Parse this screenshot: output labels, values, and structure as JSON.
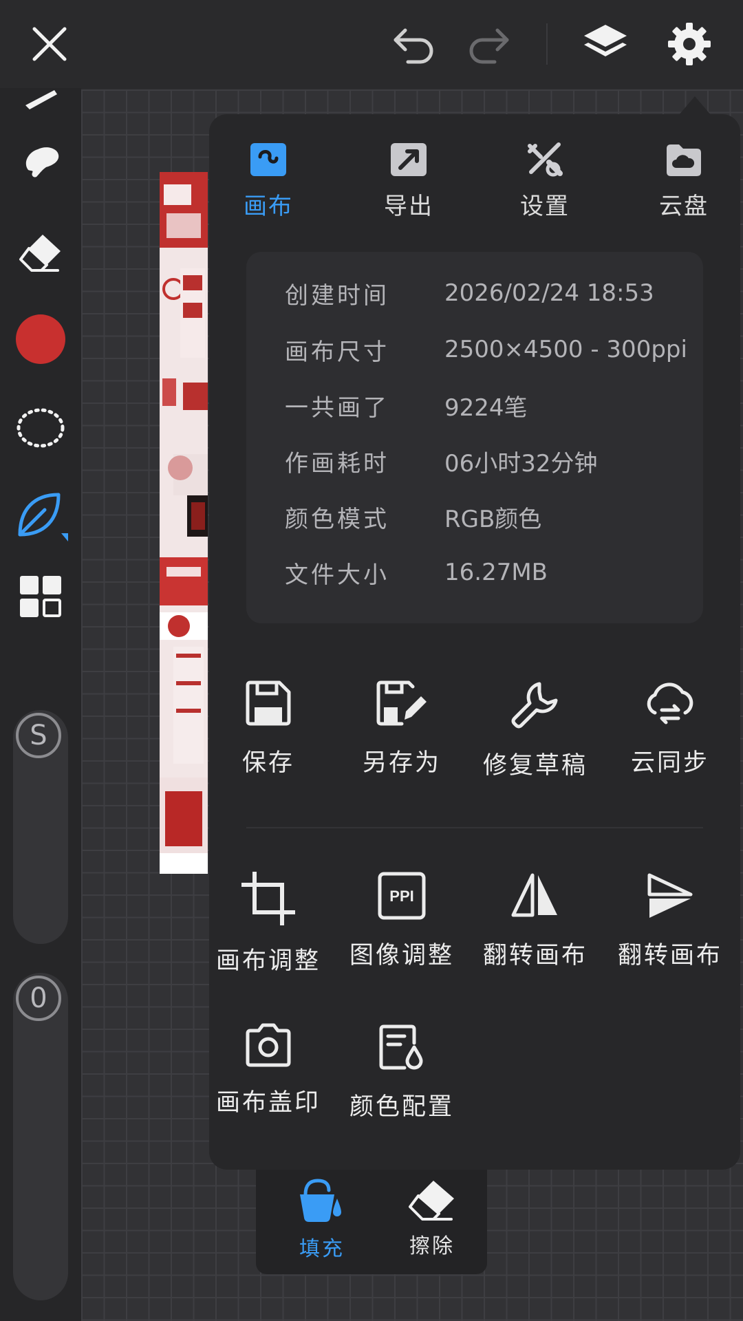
{
  "colors": {
    "accent": "#3a9cf5",
    "brush_color": "#c8302f",
    "panel_bg": "#272729"
  },
  "topbar": {
    "close_icon": "close-icon",
    "undo_icon": "undo-icon",
    "redo_icon": "redo-icon",
    "layers_icon": "layers-icon",
    "settings_icon": "gear-icon"
  },
  "sidebar": {
    "size_slider_label": "S",
    "opacity_slider_label": "0"
  },
  "panel": {
    "tabs": [
      {
        "label": "画布",
        "icon": "canvas-icon",
        "active": true
      },
      {
        "label": "导出",
        "icon": "export-icon",
        "active": false
      },
      {
        "label": "设置",
        "icon": "tools-icon",
        "active": false
      },
      {
        "label": "云盘",
        "icon": "cloud-drive-icon",
        "active": false
      }
    ],
    "info": [
      {
        "key": "创建时间",
        "value": "2026/02/24 18:53"
      },
      {
        "key": "画布尺寸",
        "value": "2500×4500 - 300ppi"
      },
      {
        "key": "一共画了",
        "value": "9224笔"
      },
      {
        "key": "作画耗时",
        "value": "06小时32分钟"
      },
      {
        "key": "颜色模式",
        "value": "RGB颜色"
      },
      {
        "key": "文件大小",
        "value": "16.27MB"
      }
    ],
    "file_actions": [
      {
        "label": "保存",
        "icon": "save-icon"
      },
      {
        "label": "另存为",
        "icon": "save-as-icon"
      },
      {
        "label": "修复草稿",
        "icon": "wrench-icon"
      },
      {
        "label": "云同步",
        "icon": "cloud-sync-icon"
      }
    ],
    "canvas_actions": [
      {
        "label": "画布调整",
        "icon": "crop-icon"
      },
      {
        "label": "图像调整",
        "icon": "ppi-icon",
        "icon_text": "PPI"
      },
      {
        "label": "翻转画布",
        "icon": "flip-horizontal-icon"
      },
      {
        "label": "翻转画布",
        "icon": "flip-vertical-icon"
      },
      {
        "label": "画布盖印",
        "icon": "camera-icon"
      },
      {
        "label": "颜色配置",
        "icon": "color-profile-icon"
      }
    ]
  },
  "mini_menu": [
    {
      "label": "填充",
      "icon": "paint-bucket-icon",
      "active": true
    },
    {
      "label": "擦除",
      "icon": "eraser-icon",
      "active": false
    }
  ]
}
